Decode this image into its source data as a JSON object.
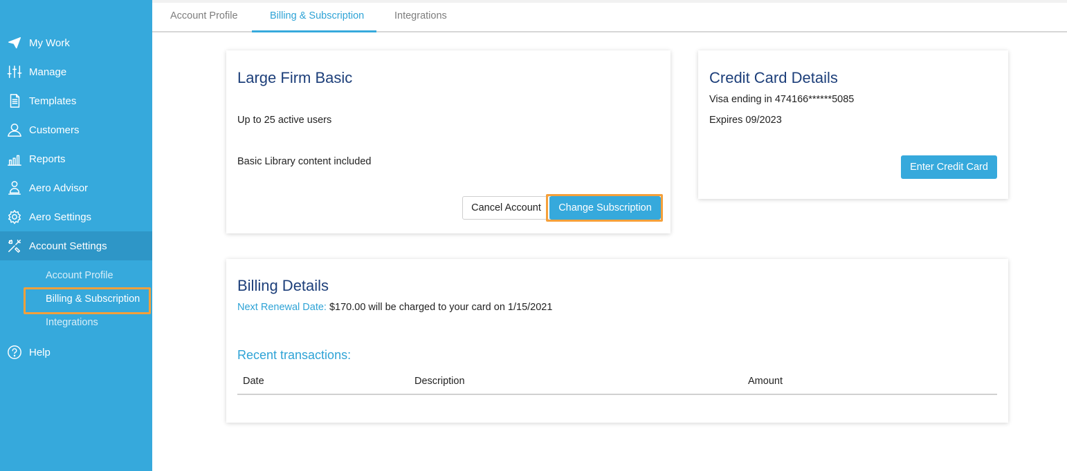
{
  "sidebar": {
    "items": [
      {
        "label": "My Work",
        "icon": "paper-plane-icon"
      },
      {
        "label": "Manage",
        "icon": "sliders-icon"
      },
      {
        "label": "Templates",
        "icon": "document-icon"
      },
      {
        "label": "Customers",
        "icon": "user-icon"
      },
      {
        "label": "Reports",
        "icon": "bar-chart-icon"
      },
      {
        "label": "Aero Advisor",
        "icon": "advisor-icon"
      },
      {
        "label": "Aero Settings",
        "icon": "gear-icon"
      },
      {
        "label": "Account Settings",
        "icon": "tools-icon"
      }
    ],
    "sub_items": [
      "Account Profile",
      "Billing & Subscription",
      "Integrations"
    ],
    "help": {
      "label": "Help",
      "icon": "help-circle-icon"
    }
  },
  "tabs": [
    "Account Profile",
    "Billing & Subscription",
    "Integrations"
  ],
  "plan": {
    "title": "Large Firm Basic",
    "feature1": "Up to 25 active users",
    "feature2": "Basic Library content included",
    "cancel_label": "Cancel Account",
    "change_label": "Change Subscription"
  },
  "credit_card": {
    "title": "Credit Card Details",
    "card_line": "Visa ending in 474166******5085",
    "expires": "Expires 09/2023",
    "enter_label": "Enter Credit Card"
  },
  "billing": {
    "title": "Billing Details",
    "renewal_label": "Next Renewal Date:",
    "renewal_text": "$170.00 will be charged to your card on 1/15/2021",
    "recent_title": "Recent transactions:",
    "columns": [
      "Date",
      "Description",
      "Amount"
    ]
  },
  "colors": {
    "sidebar": "#36a9dc",
    "accent": "#2ea3d6",
    "title": "#1d3f7a",
    "highlight": "#f5a03a"
  }
}
